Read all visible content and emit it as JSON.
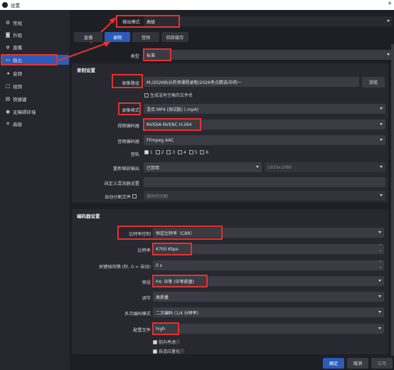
{
  "window": {
    "title": "设置"
  },
  "sidebar": {
    "items": [
      {
        "label": "常规",
        "icon": "gear-icon"
      },
      {
        "label": "外观",
        "icon": "palette-icon"
      },
      {
        "label": "直播",
        "icon": "antenna-icon"
      },
      {
        "label": "输出",
        "icon": "monitor-icon"
      },
      {
        "label": "音频",
        "icon": "speaker-icon"
      },
      {
        "label": "视频",
        "icon": "screen-icon"
      },
      {
        "label": "快捷键",
        "icon": "keyboard-icon"
      },
      {
        "label": "无障碍环境",
        "icon": "accessibility-icon"
      },
      {
        "label": "高级",
        "icon": "tools-icon"
      }
    ],
    "selected": "输出"
  },
  "output_mode": {
    "label": "输出模式",
    "value": "高级"
  },
  "tabs": [
    "直播",
    "录制",
    "音频",
    "回放缓存"
  ],
  "active_tab": "录制",
  "type": {
    "label": "类型",
    "value": "标准"
  },
  "recording": {
    "section": "录制设置",
    "path_label": "录像路径",
    "path_value": "M:/2026执业药师课程录制/2026考点精讲/中药一",
    "browse": "浏览",
    "no_space_label": "生成没有空格的文件名",
    "format_label": "录像格式",
    "format_value": "混合 MP4 (测试版) (.mp4)",
    "video_encoder_label": "视频编码器",
    "video_encoder_value": "NVIDIA NVENC H.264",
    "audio_encoder_label": "音频编码器",
    "audio_encoder_value": "FFmpeg AAC",
    "tracks_label": "音轨",
    "tracks": [
      "1",
      "2",
      "3",
      "4",
      "5",
      "6"
    ],
    "rescale_label": "重新缩放输出",
    "rescale_value": "已禁用",
    "rescale_res": "1920x1080",
    "custom_muxer_label": "自定义混流器设置",
    "auto_split_label": "自动分割文件",
    "auto_split_value": "按时间分割"
  },
  "encoder": {
    "section": "编码器设置",
    "rate_control_label": "比特率控制",
    "rate_control_value": "恒定比特率（CBR）",
    "bitrate_label": "比特率",
    "bitrate_value": "6700 Kbps",
    "keyframe_label": "关键帧间隔 (秒, 0 = 自动)",
    "keyframe_value": "0 s",
    "preset_label": "预设",
    "preset_value": "P4: 中等 (中等质量)",
    "tuning_label": "调节",
    "tuning_value": "高质量",
    "multipass_label": "多次编码模式",
    "multipass_value": "二次编码 (1/4 分辨率)",
    "profile_label": "配置文件",
    "profile_value": "high",
    "lookahead_label": "前向考虑",
    "psycho_label": "自适应量化"
  },
  "footer": {
    "ok": "确定",
    "cancel": "取消",
    "apply": "应用"
  },
  "colors": {
    "accent": "#2c5cb9",
    "highlight": "#e5322d",
    "background": "#1e1f25"
  }
}
